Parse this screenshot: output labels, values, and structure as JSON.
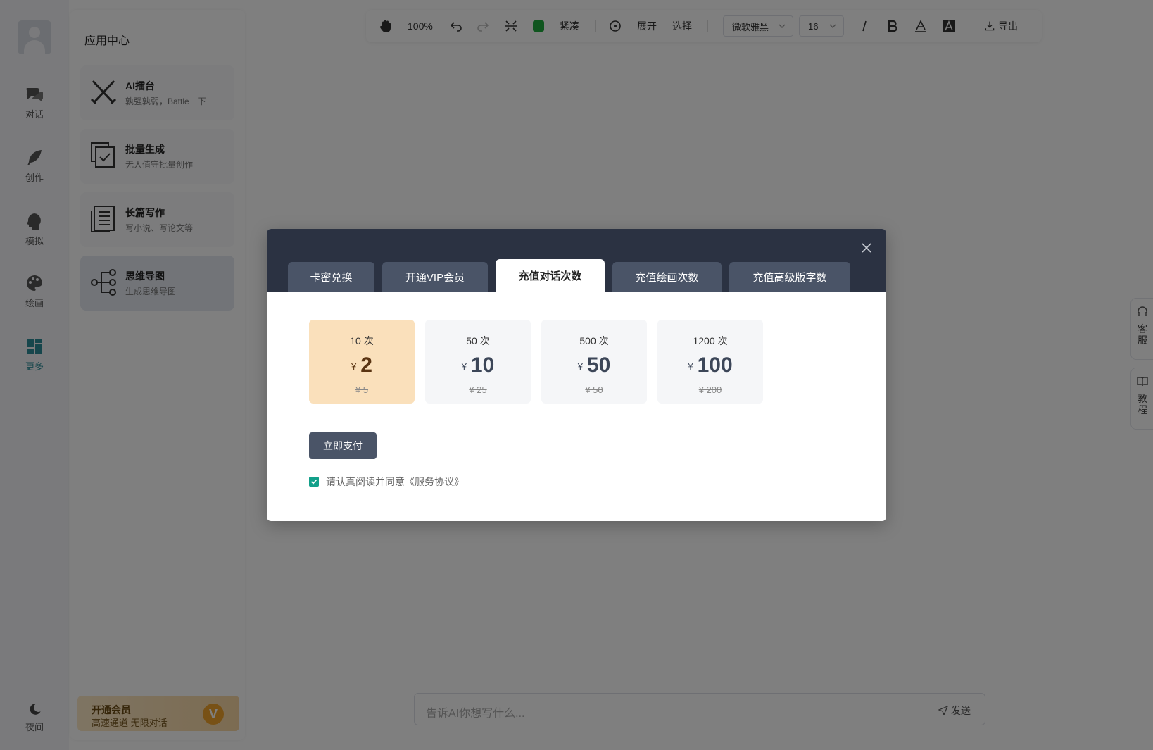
{
  "app": {
    "panel_title": "应用中心"
  },
  "rail": {
    "items": [
      {
        "label": "对话",
        "icon": "chat-icon"
      },
      {
        "label": "创作",
        "icon": "feather-icon"
      },
      {
        "label": "模拟",
        "icon": "head-icon"
      },
      {
        "label": "绘画",
        "icon": "palette-icon"
      },
      {
        "label": "更多",
        "icon": "grid-icon",
        "active": true
      }
    ],
    "night_label": "夜间"
  },
  "apps": [
    {
      "title": "AI擂台",
      "desc": "孰强孰弱，Battle一下",
      "icon": "crossed-swords-icon"
    },
    {
      "title": "批量生成",
      "desc": "无人值守批量创作",
      "icon": "batch-icon"
    },
    {
      "title": "长篇写作",
      "desc": "写小说、写论文等",
      "icon": "document-icon"
    },
    {
      "title": "思维导图",
      "desc": "生成思维导图",
      "icon": "mindmap-icon",
      "active": true
    }
  ],
  "vip": {
    "title": "开通会员",
    "subtitle": "高速通道 无限对话"
  },
  "toolbar": {
    "zoom": "100%",
    "compact_label": "紧凑",
    "expand_label": "展开",
    "select_label": "选择",
    "font_family": "微软雅黑",
    "font_size": "16",
    "export_label": "导出",
    "color": "#1faa3c"
  },
  "input": {
    "placeholder": "告诉AI你想写什么...",
    "send_label": "发送"
  },
  "side_tabs": [
    {
      "label": "客服",
      "icon": "headset-icon"
    },
    {
      "label": "教程",
      "icon": "book-icon"
    }
  ],
  "modal": {
    "tabs": [
      {
        "label": "卡密兑换"
      },
      {
        "label": "开通VIP会员"
      },
      {
        "label": "充值对话次数",
        "active": true
      },
      {
        "label": "充值绘画次数"
      },
      {
        "label": "充值高级版字数"
      }
    ],
    "currency": "¥",
    "plans": [
      {
        "count": "10 次",
        "price": "2",
        "original": "¥ 5",
        "selected": true
      },
      {
        "count": "50 次",
        "price": "10",
        "original": "¥ 25"
      },
      {
        "count": "500 次",
        "price": "50",
        "original": "¥ 50"
      },
      {
        "count": "1200 次",
        "price": "100",
        "original": "¥ 200"
      }
    ],
    "pay_label": "立即支付",
    "agreement_text": "请认真阅读并同意《服务协议》",
    "agreement_checked": true
  }
}
